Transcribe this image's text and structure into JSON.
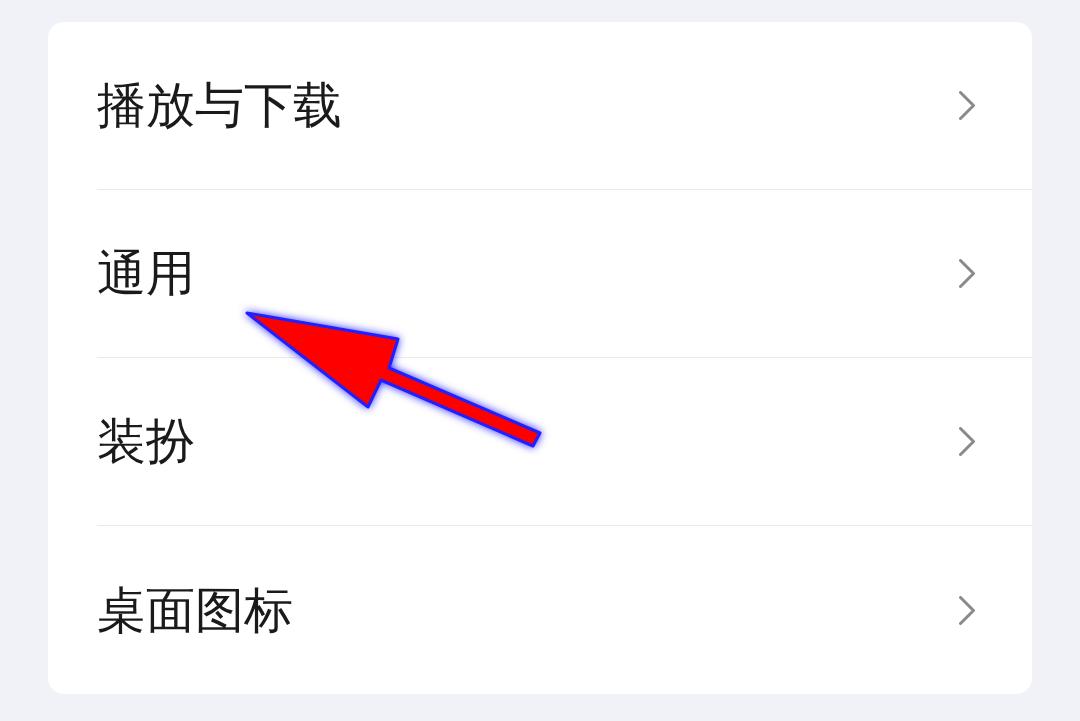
{
  "settings": {
    "items": [
      {
        "label": "播放与下载"
      },
      {
        "label": "通用"
      },
      {
        "label": "装扮"
      },
      {
        "label": "桌面图标"
      }
    ]
  }
}
